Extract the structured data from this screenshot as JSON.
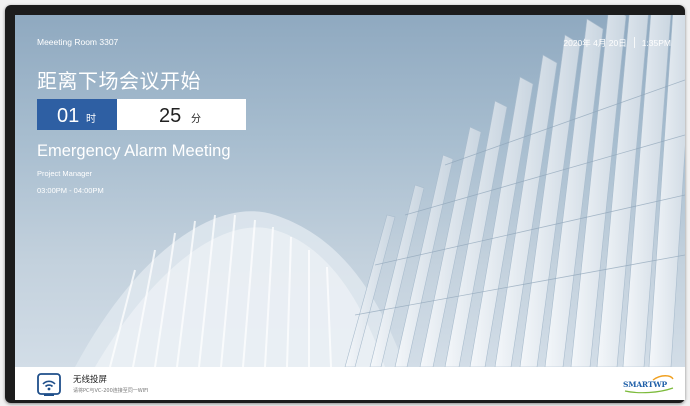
{
  "topbar": {
    "room_name": "Meeeting Room 3307",
    "date": "2020年 4月 20日",
    "time": "1:35PM"
  },
  "countdown": {
    "headline": "距离下场会议开始",
    "hours_value": "01",
    "hours_unit": "时",
    "minutes_value": "25",
    "minutes_unit": "分"
  },
  "meeting": {
    "title": "Emergency Alarm Meeting",
    "organizer": "Project Manager",
    "time_range": "03:00PM - 04:00PM"
  },
  "bottombar": {
    "cast_icon": "wireless-cast-icon",
    "cast_title": "无线投屏",
    "cast_hint": "请将PC与VC-200连接至同一WIFI",
    "brand": "SMARTWP"
  },
  "colors": {
    "accent": "#2e5fa3",
    "brand": "#1f5fa8",
    "icon": "#1f4f8a"
  }
}
